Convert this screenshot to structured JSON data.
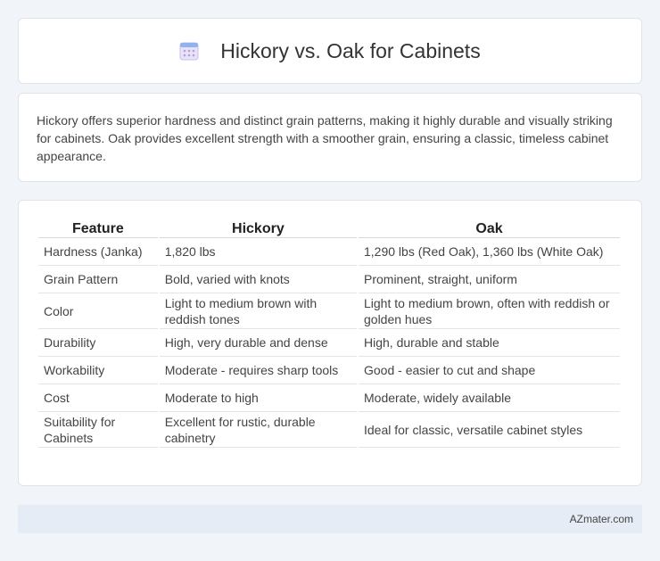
{
  "header": {
    "title": "Hickory vs. Oak for Cabinets",
    "icon": "calendar-icon"
  },
  "intro": {
    "text": "Hickory offers superior hardness and distinct grain patterns, making it highly durable and visually striking for cabinets. Oak provides excellent strength with a smoother grain, ensuring a classic, timeless cabinet appearance."
  },
  "table": {
    "headers": [
      "Feature",
      "Hickory",
      "Oak"
    ],
    "rows": [
      [
        "Hardness (Janka)",
        "1,820 lbs",
        "1,290 lbs (Red Oak), 1,360 lbs (White Oak)"
      ],
      [
        "Grain Pattern",
        "Bold, varied with knots",
        "Prominent, straight, uniform"
      ],
      [
        "Color",
        "Light to medium brown with reddish tones",
        "Light to medium brown, often with reddish or golden hues"
      ],
      [
        "Durability",
        "High, very durable and dense",
        "High, durable and stable"
      ],
      [
        "Workability",
        "Moderate - requires sharp tools",
        "Good - easier to cut and shape"
      ],
      [
        "Cost",
        "Moderate to high",
        "Moderate, widely available"
      ],
      [
        "Suitability for Cabinets",
        "Excellent for rustic, durable cabinetry",
        "Ideal for classic, versatile cabinet styles"
      ]
    ]
  },
  "footer": {
    "site": "AZmater.com"
  }
}
